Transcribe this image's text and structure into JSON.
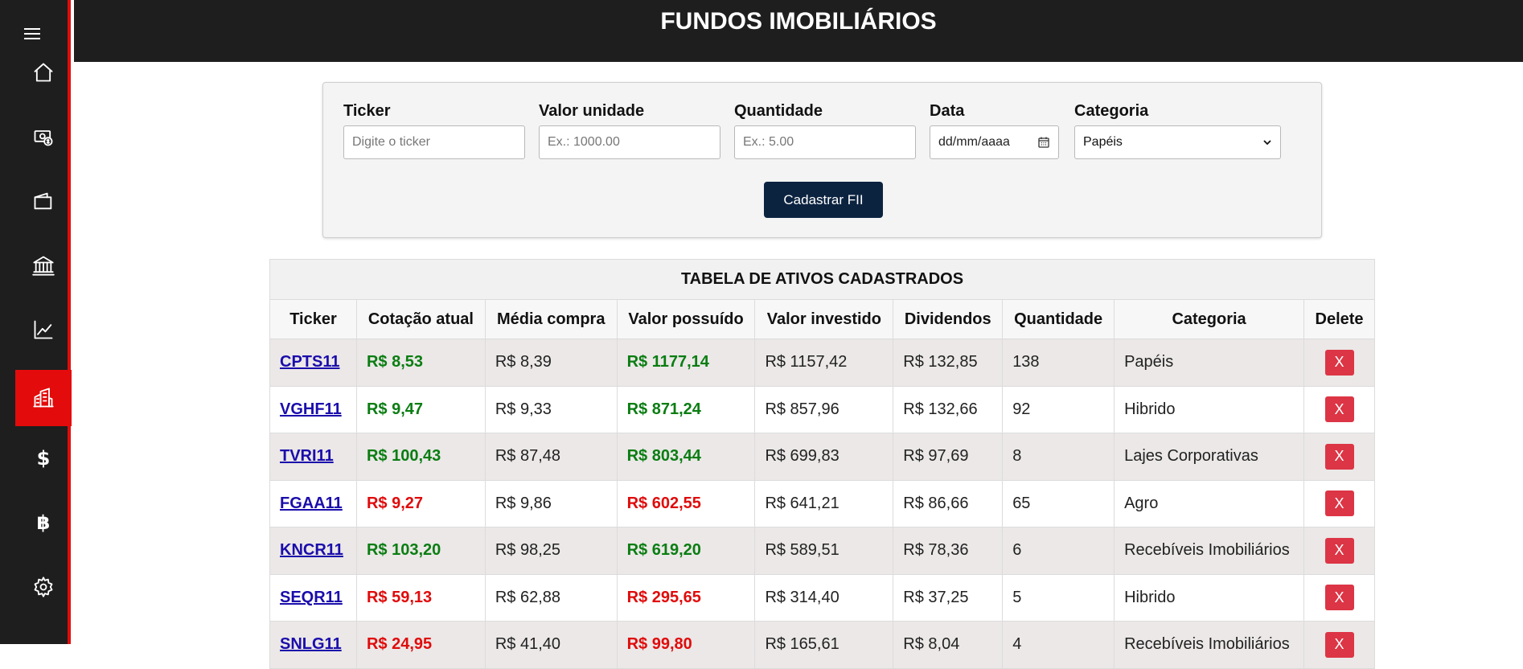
{
  "header": {
    "title": "FUNDOS IMOBILIÁRIOS"
  },
  "sidebar": {
    "items": [
      {
        "icon": "home-icon",
        "active": false
      },
      {
        "icon": "money-bag-icon",
        "active": false
      },
      {
        "icon": "wallet-icon",
        "active": false
      },
      {
        "icon": "bank-icon",
        "active": false
      },
      {
        "icon": "chart-line-icon",
        "active": false
      },
      {
        "icon": "buildings-icon",
        "active": true
      },
      {
        "icon": "dollar-icon",
        "active": false,
        "glyph": "$"
      },
      {
        "icon": "bitcoin-icon",
        "active": false,
        "glyph": "฿"
      },
      {
        "icon": "gear-icon",
        "active": false
      }
    ]
  },
  "form": {
    "ticker_label": "Ticker",
    "ticker_placeholder": "Digite o ticker",
    "valor_label": "Valor unidade",
    "valor_placeholder": "Ex.: 1000.00",
    "quantidade_label": "Quantidade",
    "quantidade_placeholder": "Ex.: 5.00",
    "data_label": "Data",
    "data_placeholder": "dd/mm/aaaa",
    "categoria_label": "Categoria",
    "categoria_value": "Papéis",
    "submit_label": "Cadastrar FII"
  },
  "table": {
    "caption": "TABELA DE ATIVOS CADASTRADOS",
    "headers": [
      "Ticker",
      "Cotação atual",
      "Média compra",
      "Valor possuído",
      "Valor investido",
      "Dividendos",
      "Quantidade",
      "Categoria",
      "Delete"
    ],
    "delete_label": "X",
    "rows": [
      {
        "ticker": "CPTS11",
        "cotacao": "R$ 8,53",
        "trend": "pos",
        "media": "R$ 8,39",
        "possuido": "R$ 1177,14",
        "investido": "R$ 1157,42",
        "dividendos": "R$ 132,85",
        "quantidade": "138",
        "categoria": "Papéis"
      },
      {
        "ticker": "VGHF11",
        "cotacao": "R$ 9,47",
        "trend": "pos",
        "media": "R$ 9,33",
        "possuido": "R$ 871,24",
        "investido": "R$ 857,96",
        "dividendos": "R$ 132,66",
        "quantidade": "92",
        "categoria": "Hibrido"
      },
      {
        "ticker": "TVRI11",
        "cotacao": "R$ 100,43",
        "trend": "pos",
        "media": "R$ 87,48",
        "possuido": "R$ 803,44",
        "investido": "R$ 699,83",
        "dividendos": "R$ 97,69",
        "quantidade": "8",
        "categoria": "Lajes Corporativas"
      },
      {
        "ticker": "FGAA11",
        "cotacao": "R$ 9,27",
        "trend": "neg",
        "media": "R$ 9,86",
        "possuido": "R$ 602,55",
        "investido": "R$ 641,21",
        "dividendos": "R$ 86,66",
        "quantidade": "65",
        "categoria": "Agro"
      },
      {
        "ticker": "KNCR11",
        "cotacao": "R$ 103,20",
        "trend": "pos",
        "media": "R$ 98,25",
        "possuido": "R$ 619,20",
        "investido": "R$ 589,51",
        "dividendos": "R$ 78,36",
        "quantidade": "6",
        "categoria": "Recebíveis Imobiliários"
      },
      {
        "ticker": "SEQR11",
        "cotacao": "R$ 59,13",
        "trend": "neg",
        "media": "R$ 62,88",
        "possuido": "R$ 295,65",
        "investido": "R$ 314,40",
        "dividendos": "R$ 37,25",
        "quantidade": "5",
        "categoria": "Hibrido"
      },
      {
        "ticker": "SNLG11",
        "cotacao": "R$ 24,95",
        "trend": "neg",
        "media": "R$ 41,40",
        "possuido": "R$ 99,80",
        "investido": "R$ 165,61",
        "dividendos": "R$ 8,04",
        "quantidade": "4",
        "categoria": "Recebíveis Imobiliários"
      }
    ]
  },
  "colors": {
    "accent": "#e30b0b",
    "sidebar_bg": "#1e1e1e",
    "button": "#0c2340",
    "positive": "#0a7d12",
    "negative": "#e00b0b",
    "delete": "#dc3545"
  }
}
